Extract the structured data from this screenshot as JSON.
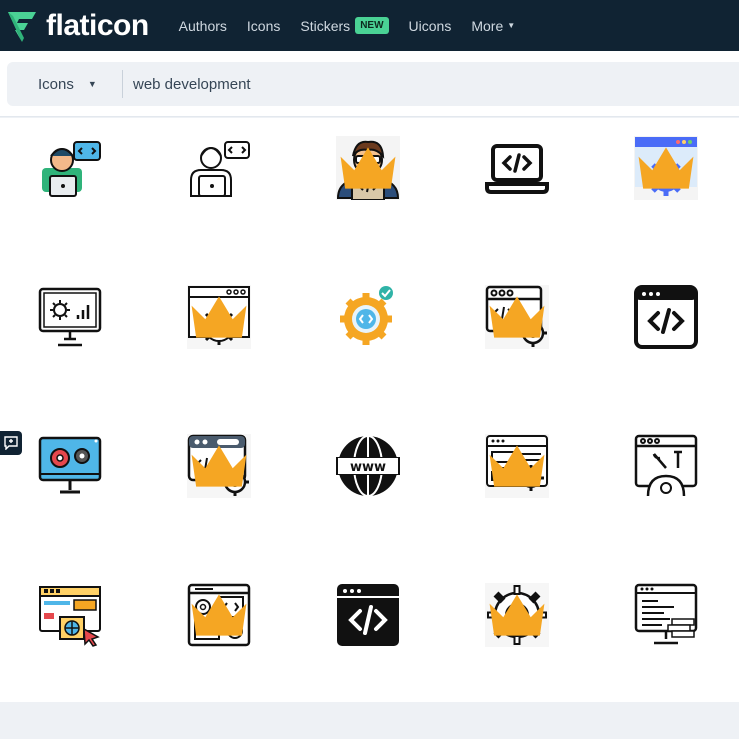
{
  "brand": {
    "name": "flaticon"
  },
  "nav": {
    "items": [
      {
        "label": "Authors"
      },
      {
        "label": "Icons"
      },
      {
        "label": "Stickers",
        "badge": "NEW"
      },
      {
        "label": "Uicons"
      },
      {
        "label": "More"
      }
    ]
  },
  "search": {
    "type_label": "Icons",
    "query": "web development",
    "placeholder": "web development"
  },
  "colors": {
    "topbar": "#102333",
    "badge": "#4ad295",
    "crown": "#f5a623",
    "accent_blue": "#4a6cf7"
  },
  "results": [
    {
      "icon": "developer-laptop-colored-icon",
      "premium": false
    },
    {
      "icon": "developer-laptop-outline-icon",
      "premium": false
    },
    {
      "icon": "programmer-glasses-icon",
      "premium": true
    },
    {
      "icon": "laptop-code-icon",
      "premium": false
    },
    {
      "icon": "browser-gear-icon",
      "premium": true
    },
    {
      "icon": "monitor-gear-chart-icon",
      "premium": false
    },
    {
      "icon": "browser-gear-outline-icon",
      "premium": true
    },
    {
      "icon": "gear-code-check-icon",
      "premium": false
    },
    {
      "icon": "browser-code-gear-icon",
      "premium": true
    },
    {
      "icon": "browser-code-solid-icon",
      "premium": false
    },
    {
      "icon": "monitor-gears-colored-icon",
      "premium": false
    },
    {
      "icon": "browser-code-gear-filled-icon",
      "premium": true
    },
    {
      "icon": "globe-www-icon",
      "premium": false
    },
    {
      "icon": "website-layout-gear-icon",
      "premium": true
    },
    {
      "icon": "browser-tools-gear-icon",
      "premium": false
    },
    {
      "icon": "web-page-globe-cursor-icon",
      "premium": false
    },
    {
      "icon": "browser-code-gears-outline-icon",
      "premium": true
    },
    {
      "icon": "code-window-black-icon",
      "premium": false
    },
    {
      "icon": "gear-code-outline-icon",
      "premium": true
    },
    {
      "icon": "monitor-code-bricks-icon",
      "premium": false
    }
  ]
}
